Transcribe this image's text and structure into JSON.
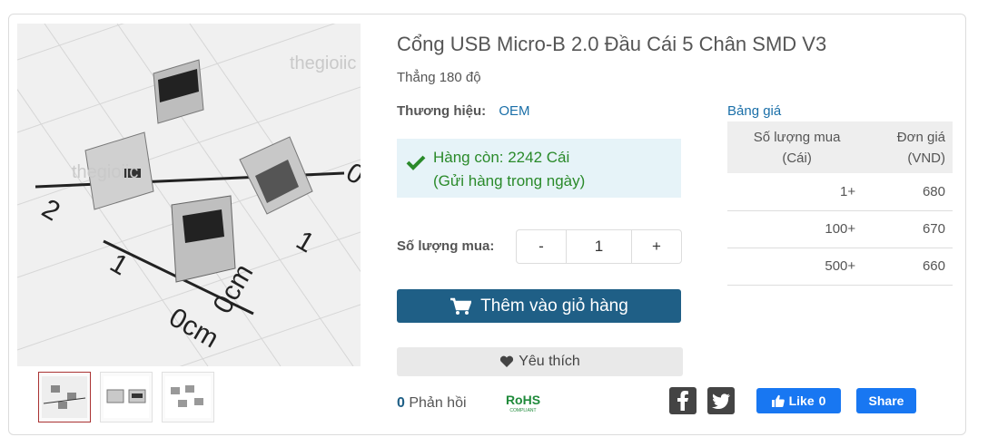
{
  "product": {
    "title": "Cổng USB Micro-B 2.0 Đầu Cái 5 Chân SMD V3",
    "subtitle": "Thẳng 180 độ",
    "brand_label": "Thương hiệu:",
    "brand_value": "OEM"
  },
  "image": {
    "ruler_labels": [
      "2",
      "1",
      "0cm",
      "1",
      "0cm",
      "0"
    ],
    "watermark": "thegioiic"
  },
  "stock": {
    "line1": "Hàng còn: 2242 Cái",
    "line2": "(Gửi hàng trong ngày)",
    "color": "#2a8a2a"
  },
  "quantity": {
    "label": "Số lượng mua:",
    "minus": "-",
    "value": "1",
    "plus": "+"
  },
  "actions": {
    "add_to_cart": "Thêm vào giỏ hàng",
    "favorite": "Yêu thích",
    "cart_color": "#1f5f86"
  },
  "footer": {
    "comment_count": "0",
    "comment_label": "Phản hồi",
    "rohs_text": "RoHS",
    "rohs_sub": "COMPLIANT",
    "like_label": "Like",
    "like_count": "0",
    "share_label": "Share"
  },
  "pricing": {
    "title": "Bảng giá",
    "header_qty_line1": "Số lượng mua",
    "header_qty_line2": "(Cái)",
    "header_price_line1": "Đơn giá",
    "header_price_line2": "(VND)",
    "rows": [
      {
        "qty": "1+",
        "price": "680"
      },
      {
        "qty": "100+",
        "price": "670"
      },
      {
        "qty": "500+",
        "price": "660"
      }
    ]
  }
}
